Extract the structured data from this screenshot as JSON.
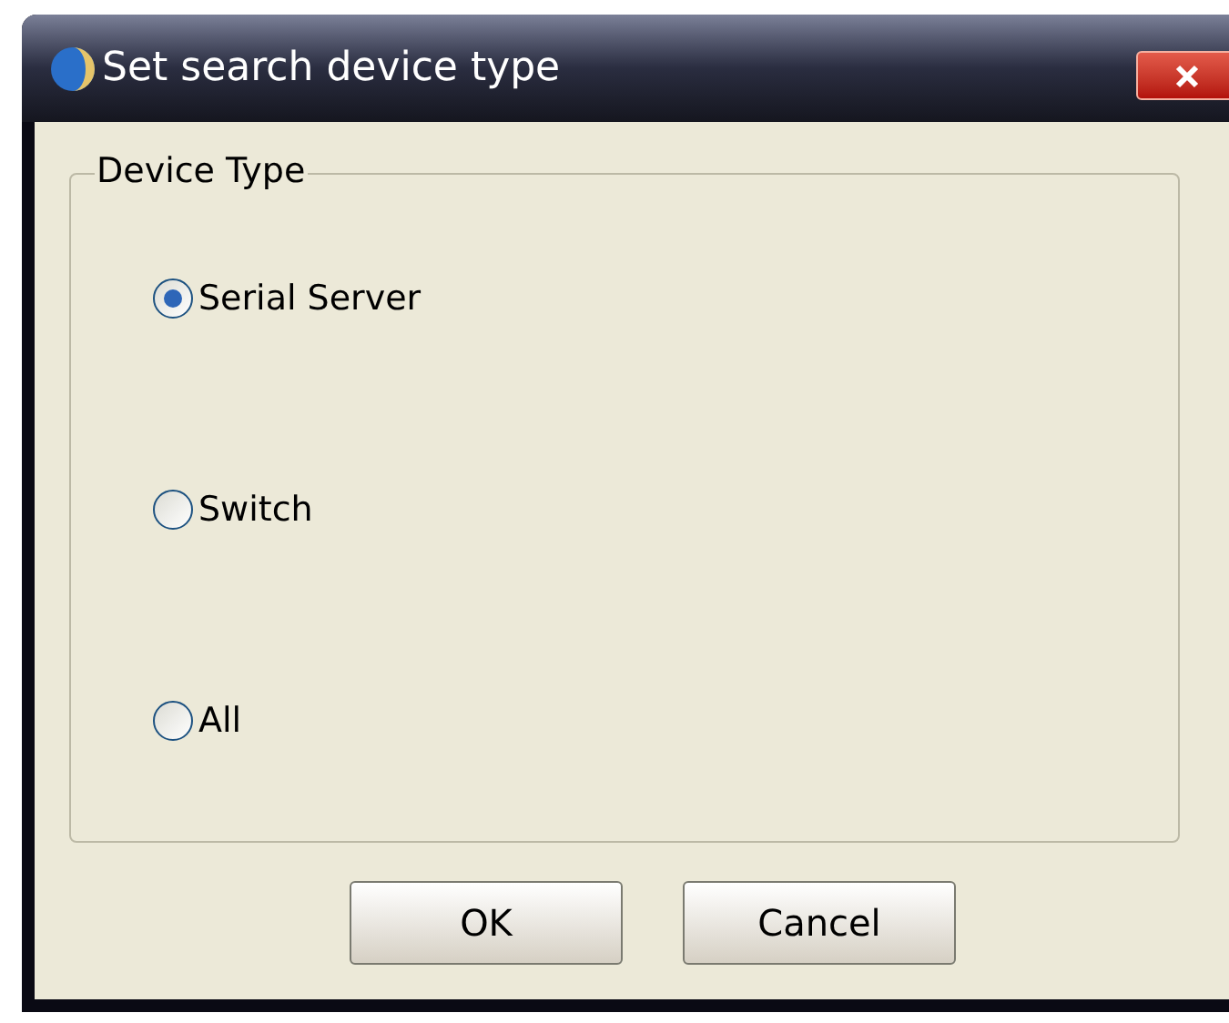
{
  "window": {
    "title": "Set search device type"
  },
  "group": {
    "label": "Device Type",
    "options": [
      {
        "label": "Serial Server",
        "selected": true
      },
      {
        "label": "Switch",
        "selected": false
      },
      {
        "label": "All",
        "selected": false
      }
    ]
  },
  "buttons": [
    "OK",
    "Cancel"
  ]
}
